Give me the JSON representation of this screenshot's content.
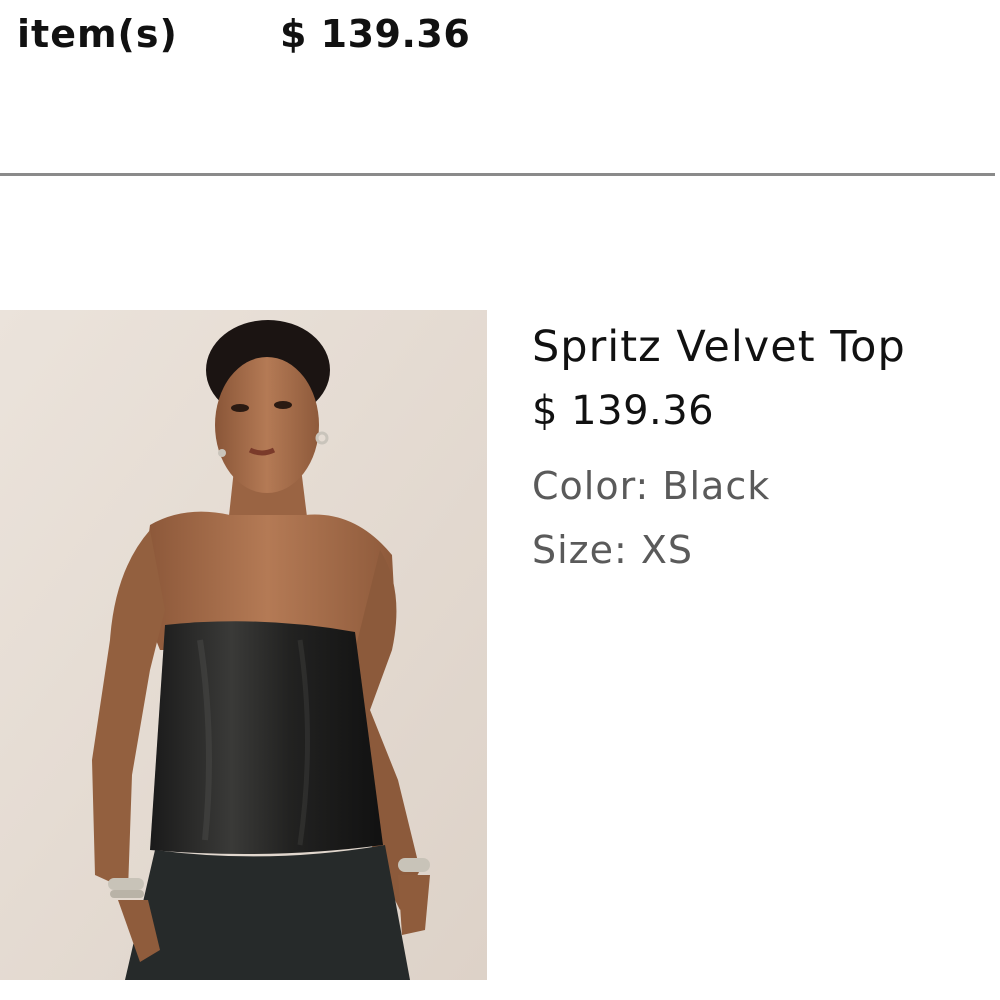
{
  "summary": {
    "items_label": "item(s)",
    "total": "$ 139.36"
  },
  "cart_items": [
    {
      "name": "Spritz Velvet Top",
      "price": "$ 139.36",
      "color": "Color: Black",
      "size": "Size: XS",
      "image_alt": "Model wearing black strapless velvet top"
    }
  ],
  "colors": {
    "text": "#111111",
    "muted": "#5a5a5a",
    "divider": "#8a8a8a",
    "photo_background": "#e6ddd5"
  }
}
